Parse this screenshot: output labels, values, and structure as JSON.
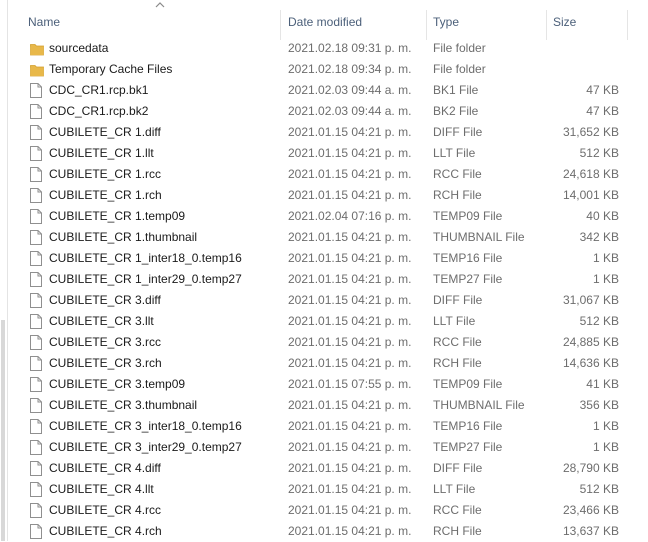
{
  "columns": {
    "name": "Name",
    "date": "Date modified",
    "type": "Type",
    "size": "Size"
  },
  "colors": {
    "folder": "#e8b84a",
    "header_text": "#4c607a"
  },
  "rows": [
    {
      "name": "sourcedata",
      "date": "2021.02.18 09:31 p. m.",
      "type": "File folder",
      "size": "",
      "icon": "folder-icon"
    },
    {
      "name": "Temporary Cache Files",
      "date": "2021.02.18 09:34 p. m.",
      "type": "File folder",
      "size": "",
      "icon": "folder-icon"
    },
    {
      "name": "CDC_CR1.rcp.bk1",
      "date": "2021.02.03 09:44 a. m.",
      "type": "BK1 File",
      "size": "47 KB",
      "icon": "file-icon"
    },
    {
      "name": "CDC_CR1.rcp.bk2",
      "date": "2021.02.03 09:44 a. m.",
      "type": "BK2 File",
      "size": "47 KB",
      "icon": "file-icon"
    },
    {
      "name": "CUBILETE_CR 1.diff",
      "date": "2021.01.15 04:21 p. m.",
      "type": "DIFF File",
      "size": "31,652 KB",
      "icon": "file-icon"
    },
    {
      "name": "CUBILETE_CR 1.llt",
      "date": "2021.01.15 04:21 p. m.",
      "type": "LLT File",
      "size": "512 KB",
      "icon": "file-icon"
    },
    {
      "name": "CUBILETE_CR 1.rcc",
      "date": "2021.01.15 04:21 p. m.",
      "type": "RCC File",
      "size": "24,618 KB",
      "icon": "file-icon"
    },
    {
      "name": "CUBILETE_CR 1.rch",
      "date": "2021.01.15 04:21 p. m.",
      "type": "RCH File",
      "size": "14,001 KB",
      "icon": "file-icon"
    },
    {
      "name": "CUBILETE_CR 1.temp09",
      "date": "2021.02.04 07:16 p. m.",
      "type": "TEMP09 File",
      "size": "40 KB",
      "icon": "file-icon"
    },
    {
      "name": "CUBILETE_CR 1.thumbnail",
      "date": "2021.01.15 04:21 p. m.",
      "type": "THUMBNAIL File",
      "size": "342 KB",
      "icon": "file-icon"
    },
    {
      "name": "CUBILETE_CR 1_inter18_0.temp16",
      "date": "2021.01.15 04:21 p. m.",
      "type": "TEMP16 File",
      "size": "1 KB",
      "icon": "file-icon"
    },
    {
      "name": "CUBILETE_CR 1_inter29_0.temp27",
      "date": "2021.01.15 04:21 p. m.",
      "type": "TEMP27 File",
      "size": "1 KB",
      "icon": "file-icon"
    },
    {
      "name": "CUBILETE_CR 3.diff",
      "date": "2021.01.15 04:21 p. m.",
      "type": "DIFF File",
      "size": "31,067 KB",
      "icon": "file-icon"
    },
    {
      "name": "CUBILETE_CR 3.llt",
      "date": "2021.01.15 04:21 p. m.",
      "type": "LLT File",
      "size": "512 KB",
      "icon": "file-icon"
    },
    {
      "name": "CUBILETE_CR 3.rcc",
      "date": "2021.01.15 04:21 p. m.",
      "type": "RCC File",
      "size": "24,885 KB",
      "icon": "file-icon"
    },
    {
      "name": "CUBILETE_CR 3.rch",
      "date": "2021.01.15 04:21 p. m.",
      "type": "RCH File",
      "size": "14,636 KB",
      "icon": "file-icon"
    },
    {
      "name": "CUBILETE_CR 3.temp09",
      "date": "2021.01.15 07:55 p. m.",
      "type": "TEMP09 File",
      "size": "41 KB",
      "icon": "file-icon"
    },
    {
      "name": "CUBILETE_CR 3.thumbnail",
      "date": "2021.01.15 04:21 p. m.",
      "type": "THUMBNAIL File",
      "size": "356 KB",
      "icon": "file-icon"
    },
    {
      "name": "CUBILETE_CR 3_inter18_0.temp16",
      "date": "2021.01.15 04:21 p. m.",
      "type": "TEMP16 File",
      "size": "1 KB",
      "icon": "file-icon"
    },
    {
      "name": "CUBILETE_CR 3_inter29_0.temp27",
      "date": "2021.01.15 04:21 p. m.",
      "type": "TEMP27 File",
      "size": "1 KB",
      "icon": "file-icon"
    },
    {
      "name": "CUBILETE_CR 4.diff",
      "date": "2021.01.15 04:21 p. m.",
      "type": "DIFF File",
      "size": "28,790 KB",
      "icon": "file-icon"
    },
    {
      "name": "CUBILETE_CR 4.llt",
      "date": "2021.01.15 04:21 p. m.",
      "type": "LLT File",
      "size": "512 KB",
      "icon": "file-icon"
    },
    {
      "name": "CUBILETE_CR 4.rcc",
      "date": "2021.01.15 04:21 p. m.",
      "type": "RCC File",
      "size": "23,466 KB",
      "icon": "file-icon"
    },
    {
      "name": "CUBILETE_CR 4.rch",
      "date": "2021.01.15 04:21 p. m.",
      "type": "RCH File",
      "size": "13,637 KB",
      "icon": "file-icon"
    }
  ]
}
